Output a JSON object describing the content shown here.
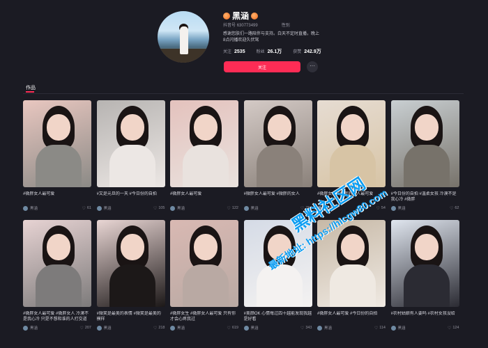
{
  "profile": {
    "name": "黑涵",
    "id_label": "抖音号",
    "id_value": "630773499",
    "location": "性别",
    "bio": "感谢您肤们一路陪伴与支持。白天不定时直播，晚上8点闪播欢迎久伏驾",
    "stats": [
      {
        "label": "关注",
        "value": "2535"
      },
      {
        "label": "粉丝",
        "value": "26.1万"
      },
      {
        "label": "获赞",
        "value": "242.9万"
      }
    ],
    "follow_label": "关注",
    "more_label": "···"
  },
  "tabs": [
    {
      "label": "作品"
    }
  ],
  "accent_color": "#fe2c55",
  "videos": [
    {
      "caption": "#微胖女人最可爱",
      "author": "黑涵",
      "likes": "61",
      "palette": [
        "#e9c7c0",
        "#8b8a86"
      ]
    },
    {
      "caption": "#又是元旦的一天 #今日份的自拍",
      "author": "黑涵",
      "likes": "105",
      "palette": [
        "#b7b4b2",
        "#ece7e4"
      ]
    },
    {
      "caption": "#微胖女人最可爱",
      "author": "黑涵",
      "likes": "122",
      "palette": [
        "#e4c2bd",
        "#e9e2de"
      ]
    },
    {
      "caption": "#微胖女人最可爱 #微胖的女人",
      "author": "黑涵",
      "likes": "754",
      "palette": [
        "#d4cac6",
        "#8a817a"
      ]
    },
    {
      "caption": "#微胖女人 #微胖的女人最可爱",
      "author": "黑涵",
      "likes": "54",
      "palette": [
        "#e6dcd2",
        "#d7c4a5"
      ]
    },
    {
      "caption": "#今日份的自拍 #温柔女孩 冷漠不是我心冷 #微胖",
      "author": "黑涵",
      "likes": "62",
      "palette": [
        "#c9cfd2",
        "#77726a"
      ]
    },
    {
      "caption": "#微胖女人最可爱 #微胖女人 冷漠不是我心冷 只是不想和谁的人打交道",
      "author": "黑涵",
      "likes": "207",
      "palette": [
        "#e7d3d3",
        "#7d7b7b"
      ]
    },
    {
      "caption": "#微笑是最美的表情 #微笑是最美的模样",
      "author": "黑涵",
      "likes": "218",
      "palette": [
        "#e9d6d4",
        "#1c1818"
      ]
    },
    {
      "caption": "#微胖女生 #微胖女人最可爱 只有你才会心疼我过",
      "author": "黑涵",
      "likes": "619",
      "palette": [
        "#d9b9b3",
        "#b9a9a3"
      ]
    },
    {
      "caption": "#美颜OK 心情每过四十越能发现我越是好看",
      "author": "黑涵",
      "likes": "343",
      "palette": [
        "#d5dbe6",
        "#f4f2f1"
      ]
    },
    {
      "caption": "#微胖女人最可爱 #今日份的自拍",
      "author": "黑涵",
      "likes": "114",
      "palette": [
        "#c7b9a7",
        "#efe9e2"
      ]
    },
    {
      "caption": "#农村姑娘有人要吗 #农村女孩没给",
      "author": "黑涵",
      "likes": "124",
      "palette": [
        "#e0e6ef",
        "#2b2b33"
      ]
    }
  ],
  "watermark": {
    "line1": "黑料社区网",
    "line2": "最新地址: https://hlcgw80.com"
  }
}
